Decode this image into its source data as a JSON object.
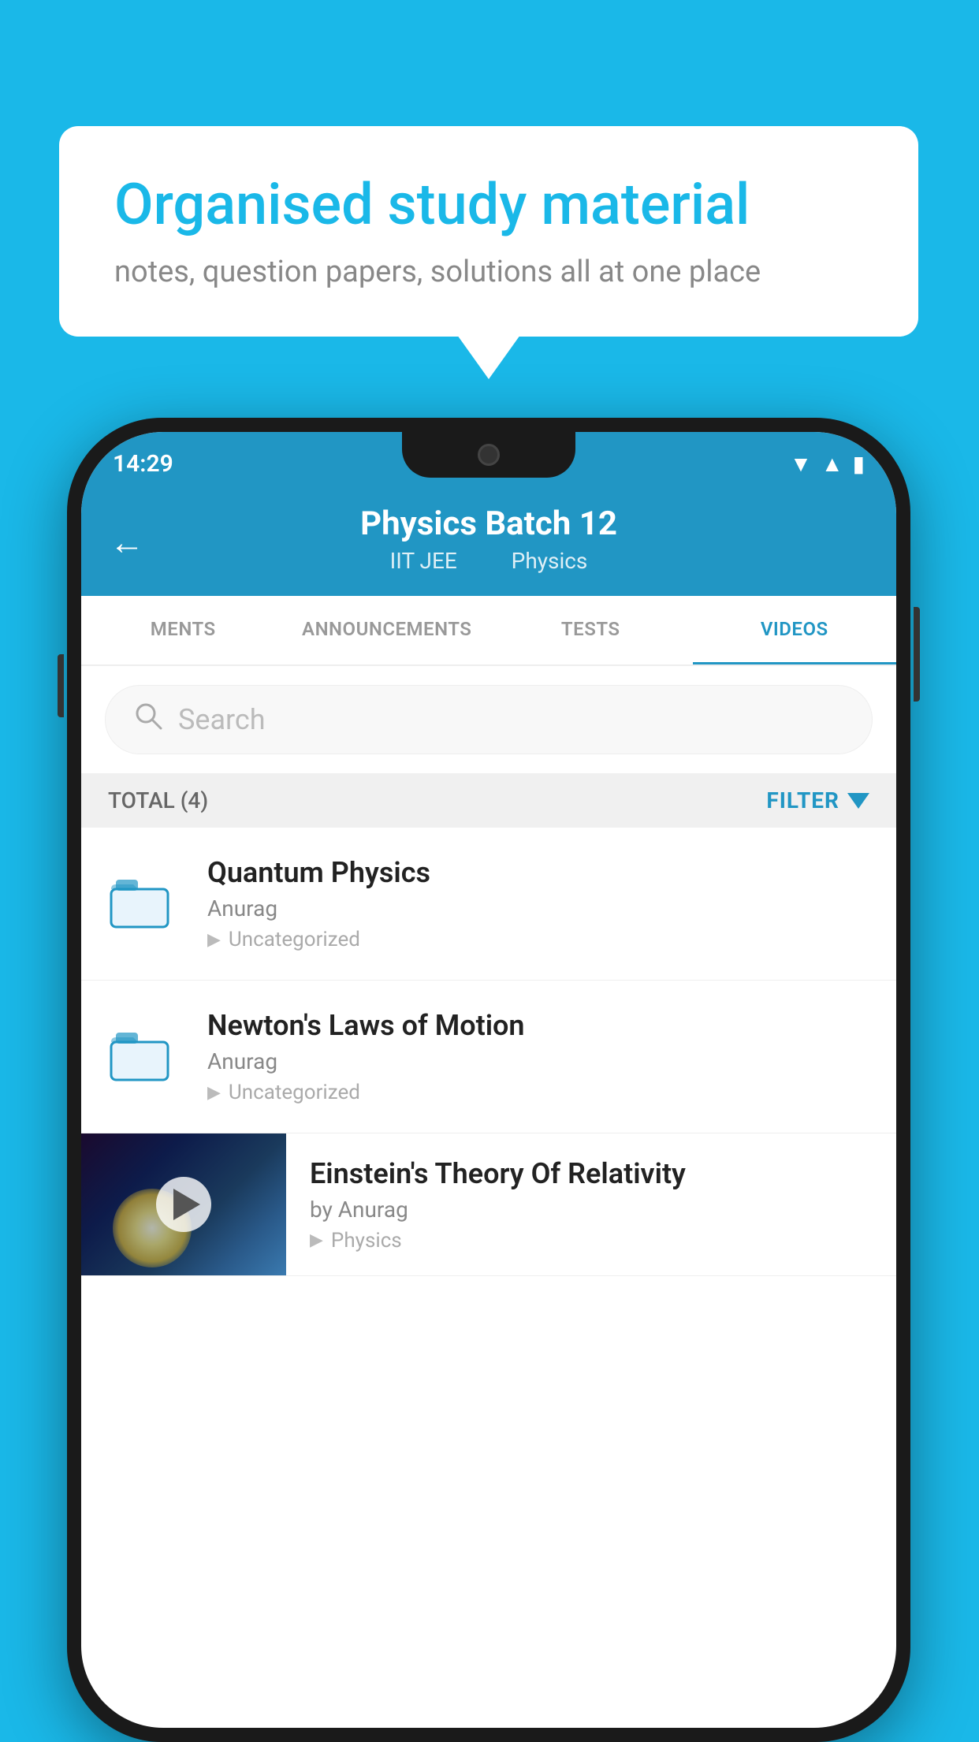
{
  "background_color": "#1ab8e8",
  "speech_bubble": {
    "title": "Organised study material",
    "subtitle": "notes, question papers, solutions all at one place"
  },
  "status_bar": {
    "time": "14:29",
    "wifi": "▲",
    "signal": "▲",
    "battery": "▮"
  },
  "header": {
    "back_arrow": "←",
    "title": "Physics Batch 12",
    "subtitle_part1": "IIT JEE",
    "subtitle_part2": "Physics"
  },
  "tabs": [
    {
      "label": "MENTS",
      "active": false
    },
    {
      "label": "ANNOUNCEMENTS",
      "active": false
    },
    {
      "label": "TESTS",
      "active": false
    },
    {
      "label": "VIDEOS",
      "active": true
    }
  ],
  "search": {
    "placeholder": "Search"
  },
  "filter_bar": {
    "total_label": "TOTAL (4)",
    "filter_label": "FILTER"
  },
  "list_items": [
    {
      "title": "Quantum Physics",
      "author": "Anurag",
      "tag": "Uncategorized",
      "type": "folder"
    },
    {
      "title": "Newton's Laws of Motion",
      "author": "Anurag",
      "tag": "Uncategorized",
      "type": "folder"
    }
  ],
  "video_item": {
    "title": "Einstein's Theory Of Relativity",
    "author": "by Anurag",
    "tag": "Physics",
    "type": "video"
  }
}
